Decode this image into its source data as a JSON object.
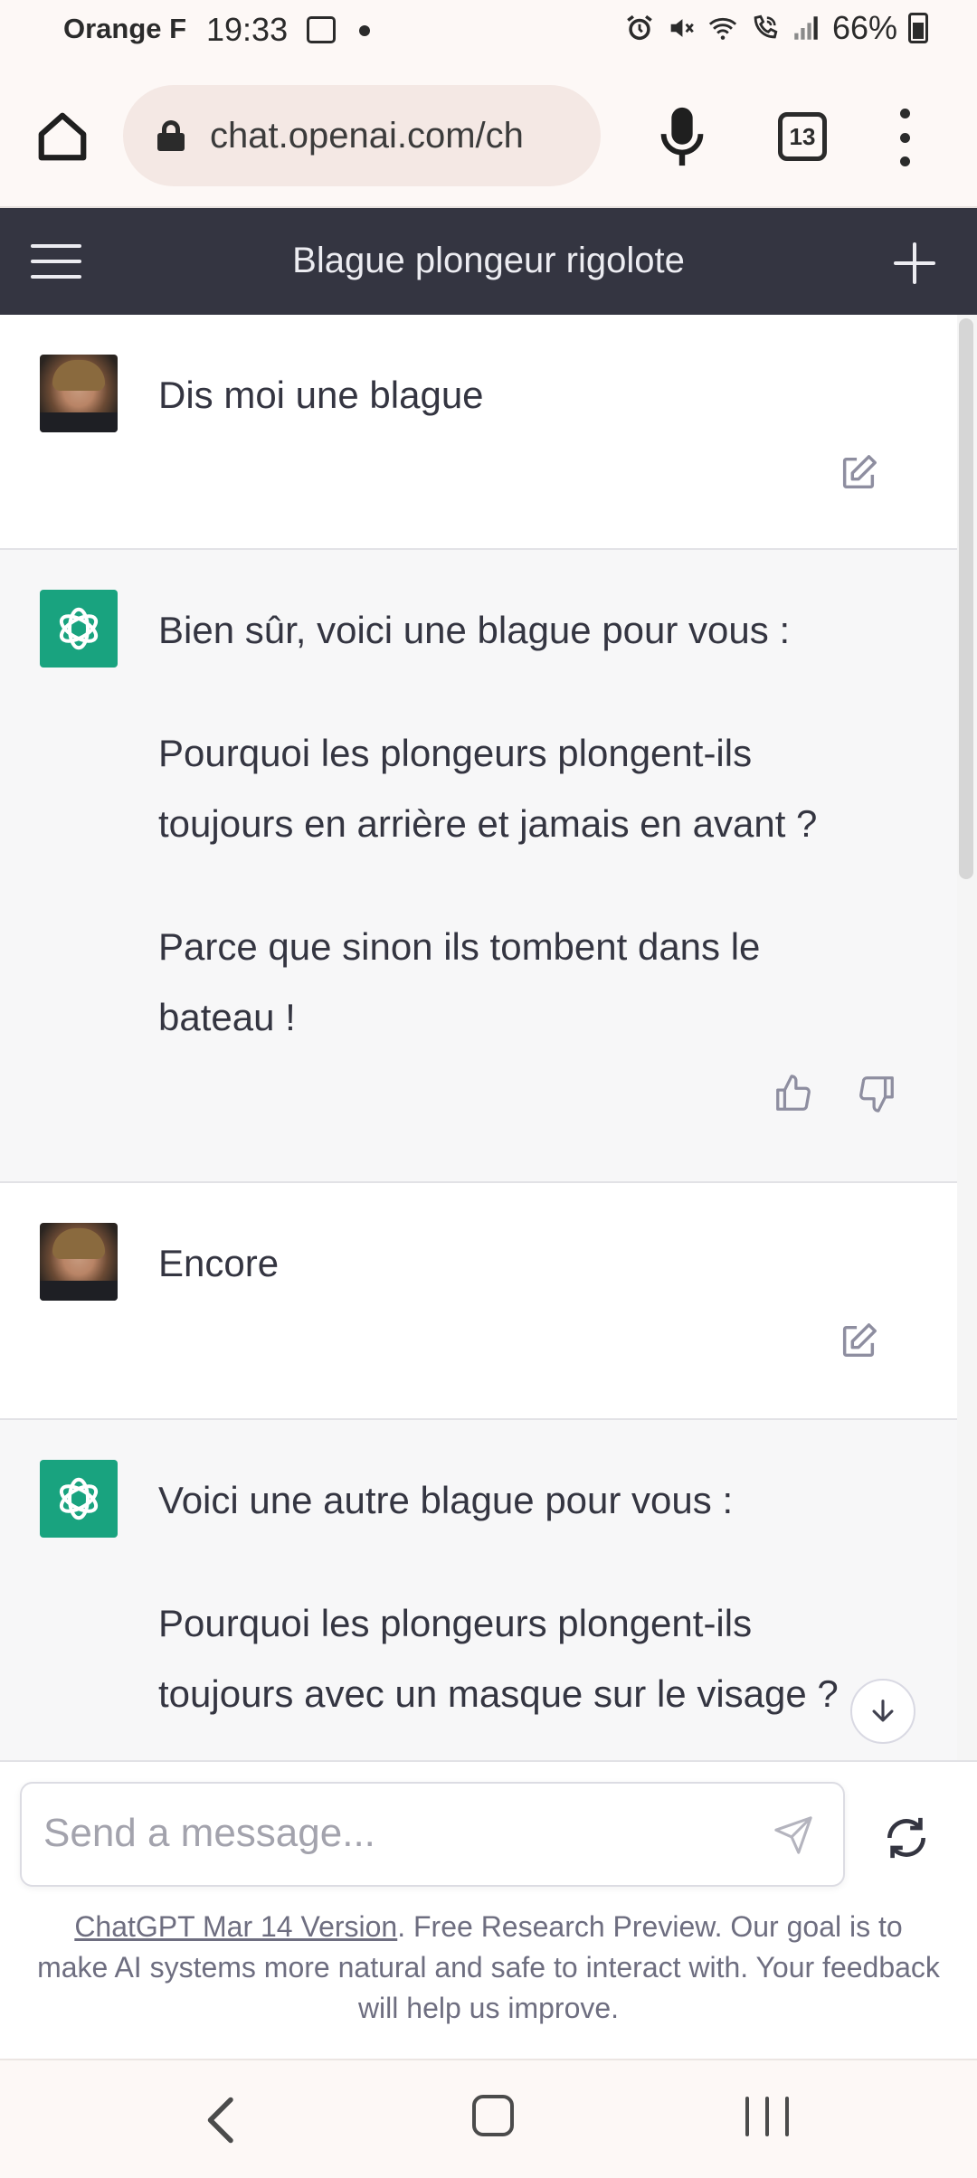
{
  "status_bar": {
    "carrier": "Orange F",
    "time": "19:33",
    "battery": "66%",
    "icons": [
      "image-icon",
      "dot-icon",
      "alarm-icon",
      "mute-icon",
      "wifi-icon",
      "wifi-calling-icon",
      "signal-icon",
      "battery-icon"
    ]
  },
  "browser": {
    "url": "chat.openai.com/ch",
    "tab_count": "13",
    "icons": [
      "home-icon",
      "lock-icon",
      "mic-icon",
      "tabs-icon",
      "more-vert-icon"
    ]
  },
  "chat_header": {
    "title": "Blague plongeur rigolote",
    "icons": [
      "hamburger-icon",
      "plus-icon"
    ]
  },
  "messages": [
    {
      "role": "user",
      "paragraphs": [
        "Dis moi une blague"
      ]
    },
    {
      "role": "assistant",
      "paragraphs": [
        "Bien sûr, voici une blague pour vous :",
        "Pourquoi les plongeurs plongent-ils toujours en arrière et jamais en avant ?",
        "Parce que sinon ils tombent dans le bateau !"
      ]
    },
    {
      "role": "user",
      "paragraphs": [
        "Encore"
      ]
    },
    {
      "role": "assistant",
      "paragraphs": [
        "Voici une autre blague pour vous :",
        "Pourquoi les plongeurs plongent-ils toujours avec un masque sur le visage ?"
      ]
    }
  ],
  "input": {
    "placeholder": "Send a message..."
  },
  "footer": {
    "link_text": "ChatGPT Mar 14 Version",
    "text": ". Free Research Preview. Our goal is to make AI systems more natural and safe to interact with. Your feedback will help us improve."
  },
  "colors": {
    "header_bg": "#343541",
    "assistant_bg": "#f7f7f8",
    "gpt_avatar": "#19a37f",
    "browser_bg": "#fdf8f6"
  }
}
